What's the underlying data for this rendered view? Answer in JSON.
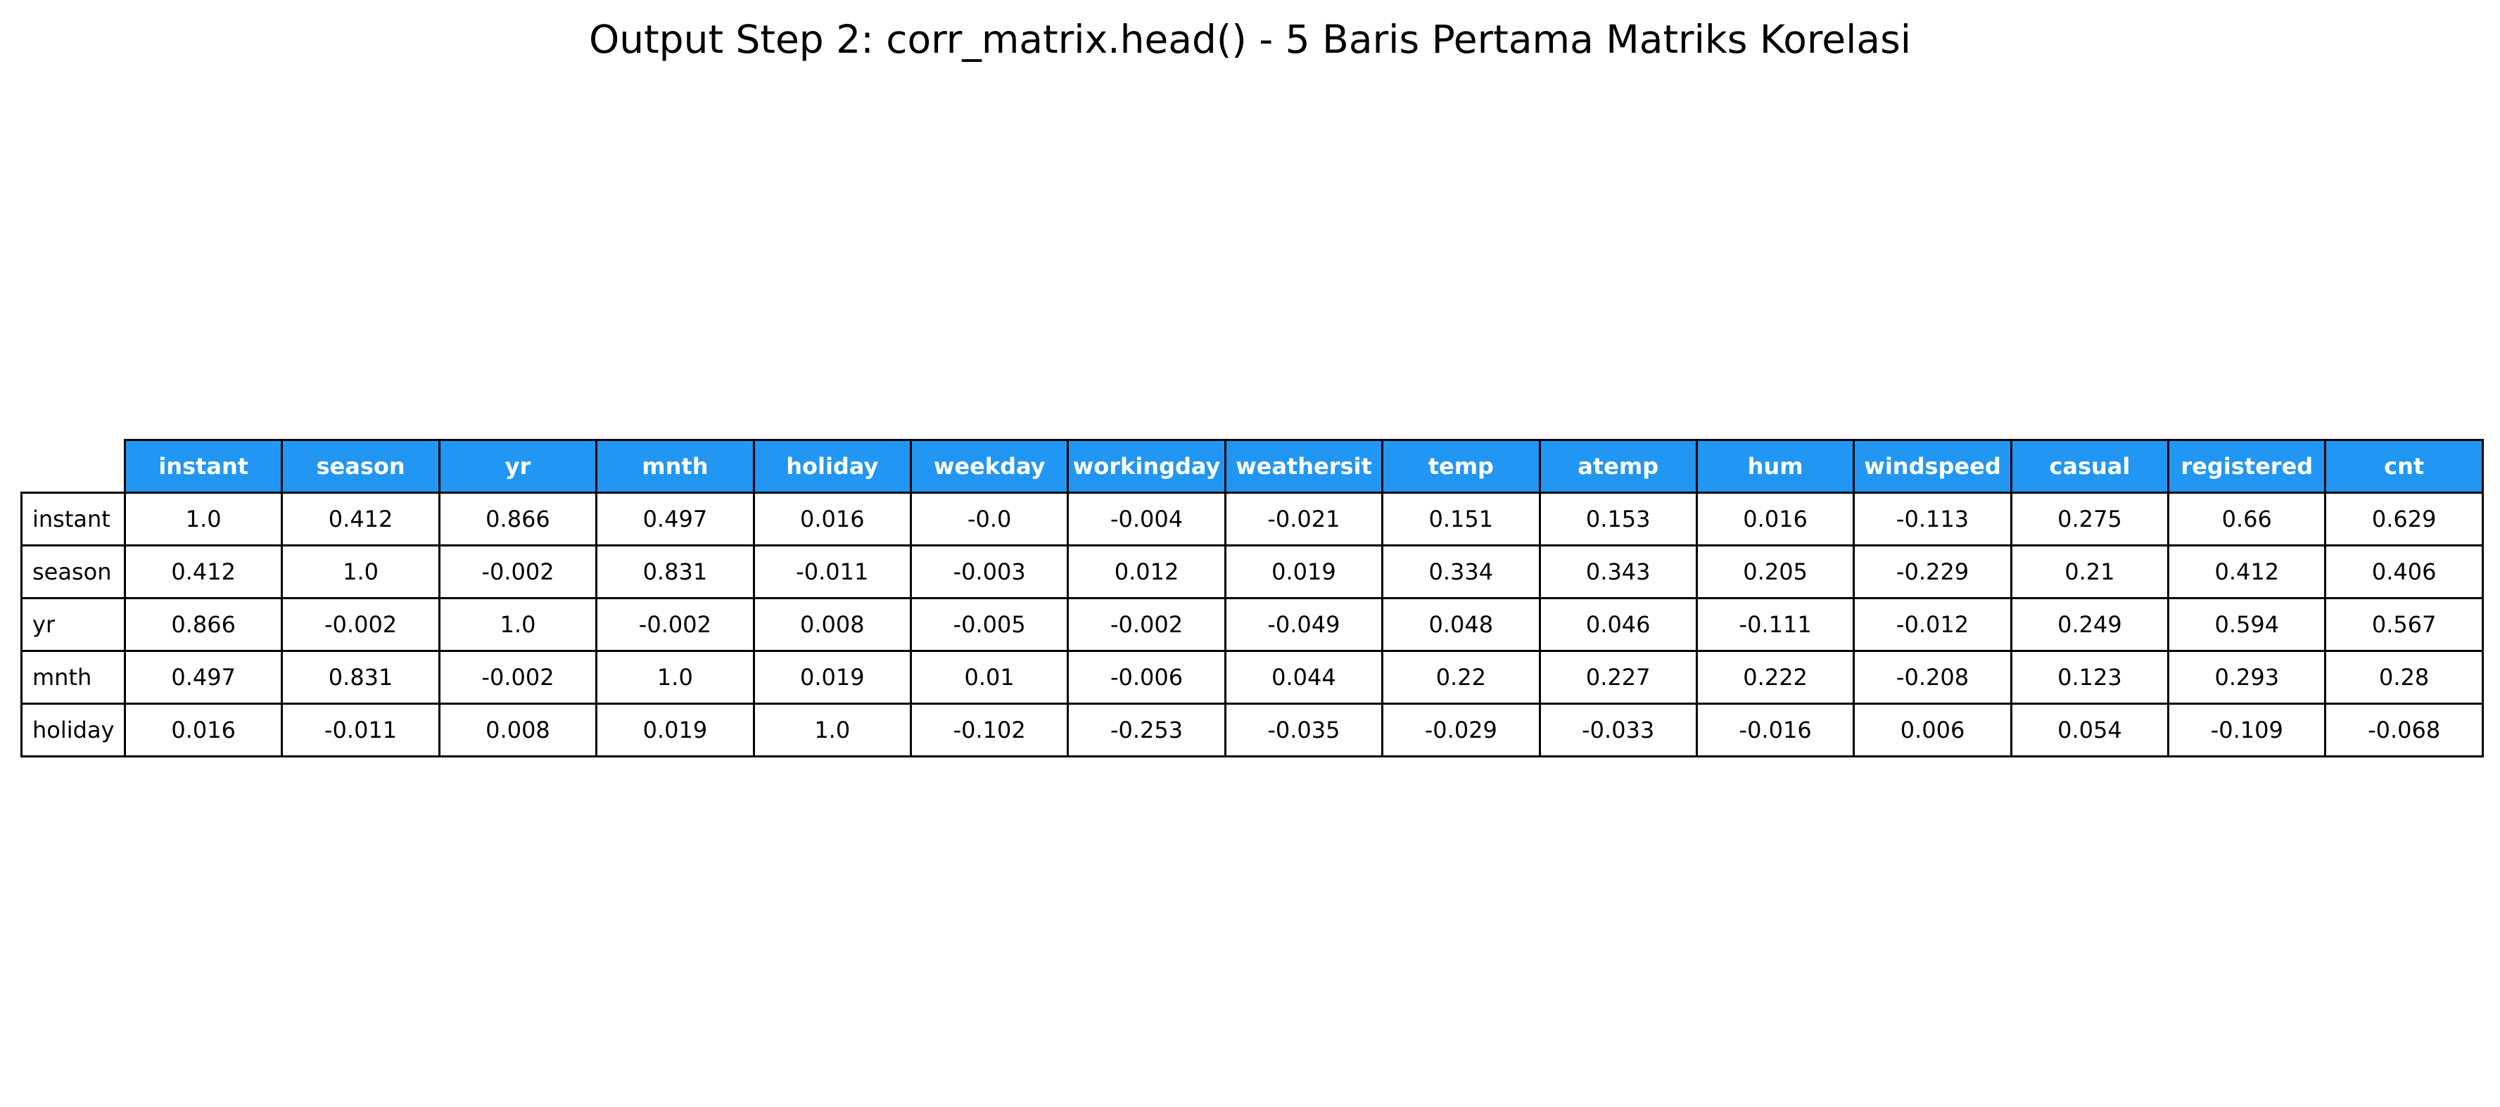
{
  "colors": {
    "header_background": "#2196f3",
    "header_text": "#ffffff",
    "cell_background": "#ffffff",
    "border": "#000000"
  },
  "chart_data": {
    "type": "table",
    "title": "Output Step 2: corr_matrix.head() - 5 Baris Pertama Matriks Korelasi",
    "columns": [
      "instant",
      "season",
      "yr",
      "mnth",
      "holiday",
      "weekday",
      "workingday",
      "weathersit",
      "temp",
      "atemp",
      "hum",
      "windspeed",
      "casual",
      "registered",
      "cnt"
    ],
    "rows": [
      {
        "label": "instant",
        "values": [
          "1.0",
          "0.412",
          "0.866",
          "0.497",
          "0.016",
          "-0.0",
          "-0.004",
          "-0.021",
          "0.151",
          "0.153",
          "0.016",
          "-0.113",
          "0.275",
          "0.66",
          "0.629"
        ]
      },
      {
        "label": "season",
        "values": [
          "0.412",
          "1.0",
          "-0.002",
          "0.831",
          "-0.011",
          "-0.003",
          "0.012",
          "0.019",
          "0.334",
          "0.343",
          "0.205",
          "-0.229",
          "0.21",
          "0.412",
          "0.406"
        ]
      },
      {
        "label": "yr",
        "values": [
          "0.866",
          "-0.002",
          "1.0",
          "-0.002",
          "0.008",
          "-0.005",
          "-0.002",
          "-0.049",
          "0.048",
          "0.046",
          "-0.111",
          "-0.012",
          "0.249",
          "0.594",
          "0.567"
        ]
      },
      {
        "label": "mnth",
        "values": [
          "0.497",
          "0.831",
          "-0.002",
          "1.0",
          "0.019",
          "0.01",
          "-0.006",
          "0.044",
          "0.22",
          "0.227",
          "0.222",
          "-0.208",
          "0.123",
          "0.293",
          "0.28"
        ]
      },
      {
        "label": "holiday",
        "values": [
          "0.016",
          "-0.011",
          "0.008",
          "0.019",
          "1.0",
          "-0.102",
          "-0.253",
          "-0.035",
          "-0.029",
          "-0.033",
          "-0.016",
          "0.006",
          "0.054",
          "-0.109",
          "-0.068"
        ]
      }
    ]
  }
}
